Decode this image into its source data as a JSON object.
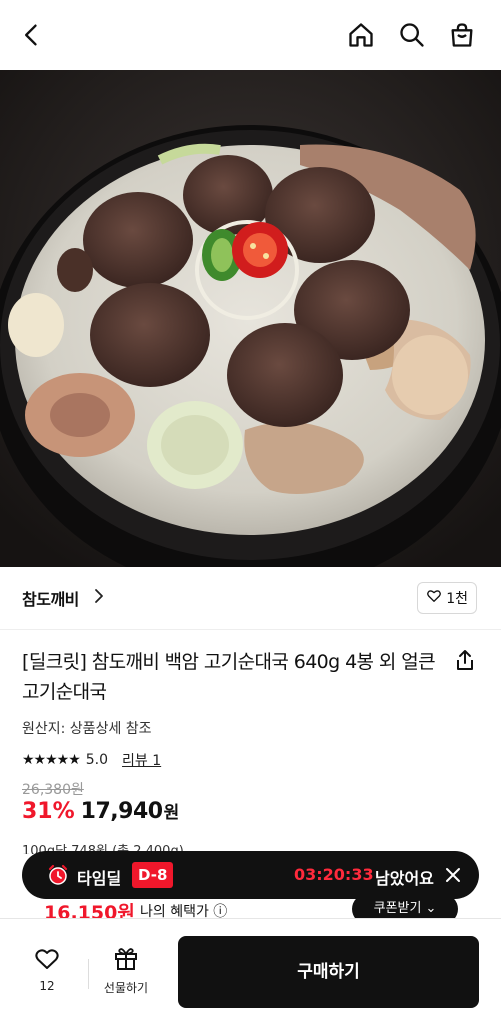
{
  "topbar": {
    "back_icon": "chevron-left-icon",
    "home_icon": "home-icon",
    "search_icon": "search-icon",
    "cart_icon": "shopping-bag-icon"
  },
  "hero": {
    "image": "soondae-gukbap-photo"
  },
  "shop": {
    "name": "참도깨비",
    "like_count": "1천"
  },
  "product": {
    "title": "[딜크릿] 참도깨비 백암 고기순대국 640g 4봉 외 얼큰 고기순대국",
    "origin": "원산지: 상품상세 참조",
    "rating": "5.0",
    "reviews": "리뷰 1",
    "original_price": "26,380원",
    "discount": "31%",
    "price": "17,940",
    "price_unit": "원",
    "unit_price": "100g당 748원 (총 2,400g)"
  },
  "benefit": {
    "price": "16,150원",
    "label": "나의 혜택가 ⓘ",
    "coupon_button": "쿠폰받기 ⌄"
  },
  "timedeal": {
    "label": "타임딜",
    "badge": "D-8",
    "time": "03:20:33",
    "remain_text": "남았어요"
  },
  "bottom": {
    "wish_count": "12",
    "gift_label": "선물하기",
    "buy_label": "구매하기"
  },
  "colors": {
    "accent": "#f0172b",
    "dark": "#111111"
  }
}
